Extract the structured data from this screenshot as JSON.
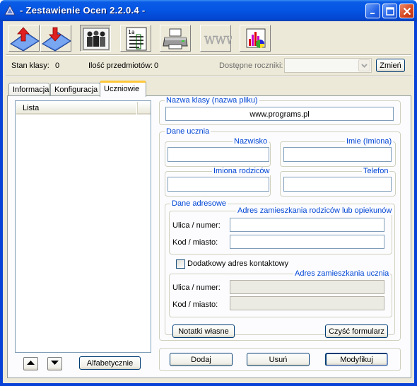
{
  "window": {
    "title": "- Zestawienie Ocen 2.2.0.4 -"
  },
  "toolbar": {
    "buttons": [
      {
        "name": "upload-icon"
      },
      {
        "name": "download-icon"
      },
      {
        "name": "students-icon"
      },
      {
        "name": "grade-table-icon"
      },
      {
        "name": "printer-icon"
      },
      {
        "name": "web-icon"
      },
      {
        "name": "chart-icon"
      }
    ]
  },
  "info": {
    "class_state_label": "Stan klasy:",
    "class_state_value": "0",
    "subjects_label": "Ilość przedmiotów:",
    "subjects_value": "0",
    "years_label": "Dostępne roczniki:",
    "years_value": "",
    "change_label": "Zmień"
  },
  "tabs": [
    {
      "label": "Informacja",
      "active": false
    },
    {
      "label": "Konfiguracja",
      "active": false
    },
    {
      "label": "Uczniowie",
      "active": true
    }
  ],
  "list": {
    "header": "Lista",
    "items": [],
    "sort_label": "Alfabetycznie"
  },
  "class_name": {
    "legend": "Nazwa klasy (nazwa pliku)",
    "value": "www.programs.pl"
  },
  "student": {
    "legend": "Dane ucznia",
    "surname": {
      "legend": "Nazwisko",
      "value": ""
    },
    "first_names": {
      "legend": "Imie (Imiona)",
      "value": ""
    },
    "parents_names": {
      "legend": "Imiona rodziców",
      "value": ""
    },
    "phone": {
      "legend": "Telefon",
      "value": ""
    }
  },
  "address": {
    "legend": "Dane adresowe",
    "parents": {
      "legend": "Adres zamieszkania rodziców lub opiekunów",
      "street_label": "Ulica / numer:",
      "street_value": "",
      "city_label": "Kod / miasto:",
      "city_value": ""
    },
    "extra_contact_label": "Dodatkowy adres kontaktowy",
    "extra_contact_checked": false,
    "student": {
      "legend": "Adres zamieszkania ucznia",
      "street_label": "Ulica / numer:",
      "street_value": "",
      "city_label": "Kod / miasto:",
      "city_value": ""
    },
    "notes_label": "Notatki własne",
    "clear_label": "Czyść formularz"
  },
  "actions": {
    "add_label": "Dodaj",
    "remove_label": "Usuń",
    "modify_label": "Modyfikuj"
  },
  "colors": {
    "title_bar": "#0554e3",
    "legend_text": "#0046d5",
    "tab_highlight": "#ffc83c",
    "client_bg": "#ece9d8"
  }
}
